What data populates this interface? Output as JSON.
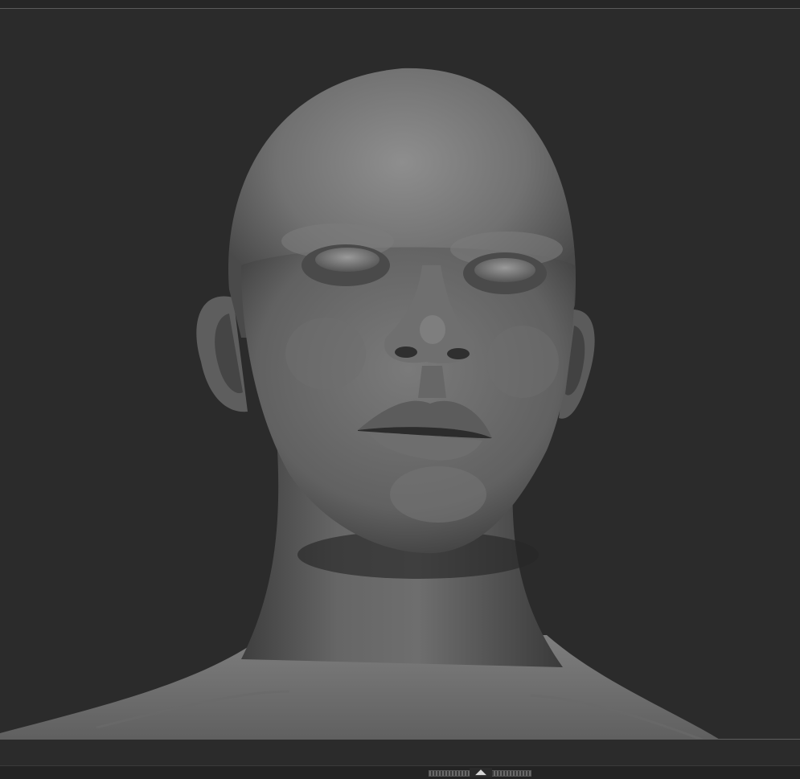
{
  "app": {
    "name": "",
    "background_color": "#2b2b2b"
  },
  "viewport": {
    "content": "sculpted-head-bust",
    "material_color": "#8a8a8a"
  },
  "bottom_shelf": {
    "toggle_glyph": "◢◣",
    "icon": "shelf-toggle-icon"
  }
}
